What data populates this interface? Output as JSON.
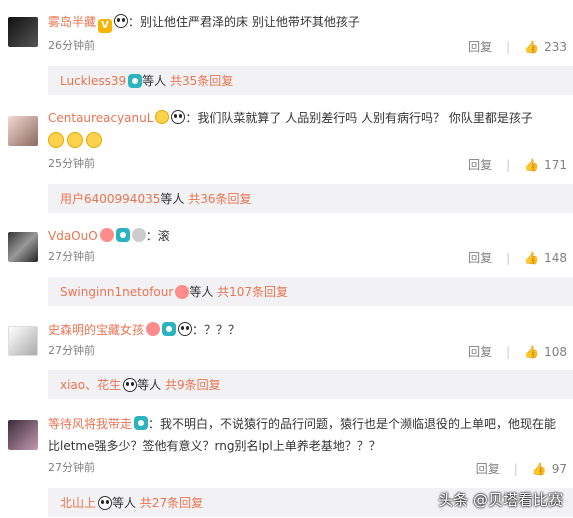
{
  "comments": [
    {
      "user": "雾岛半藏",
      "text": "：别让他住严君泽的床 别让他带坏其他孩子",
      "time": "26分钟前",
      "reply_label": "回复",
      "likes": "233",
      "replies": {
        "user": "Luckless39",
        "suffix": " 等人",
        "count": "共35条回复"
      }
    },
    {
      "user": "CentaureacyanuL",
      "text": "：我们队菜就算了  人品别差行吗  人别有病行吗？   你队里都是孩子",
      "time": "25分钟前",
      "reply_label": "回复",
      "likes": "171",
      "replies": {
        "user": "用户6400994035",
        "suffix": " 等人",
        "count": "共36条回复"
      }
    },
    {
      "user": "VdaOuO",
      "text": "：滚",
      "time": "27分钟前",
      "reply_label": "回复",
      "likes": "148",
      "replies": {
        "user": "Swinginn1netofour",
        "suffix": " 等人",
        "count": "共107条回复"
      }
    },
    {
      "user": "史森明的宝藏女孩",
      "text": "：？？？",
      "time": "27分钟前",
      "reply_label": "回复",
      "likes": "108",
      "replies": {
        "user": "xiao、花生",
        "suffix": " 等人",
        "count": "共9条回复"
      }
    },
    {
      "user": "等待风将我带走",
      "text_line1": "：我不明白，不说猿行的品行问题，猿行也是个濒临退役的上单吧，他现在能",
      "text_line2": "比letme强多少？签他有意义？rng别名lpl上单养老基地？？？",
      "time": "27分钟前",
      "reply_label": "回复",
      "likes": "97",
      "replies": {
        "user": "北山上",
        "suffix": " 等人",
        "count": "共27条回复"
      }
    }
  ],
  "watermark": "头条 @贝塔看比赛",
  "colors": {
    "username": "#eb7350",
    "reply_bg": "#f2f2f5",
    "meta": "#808080"
  }
}
